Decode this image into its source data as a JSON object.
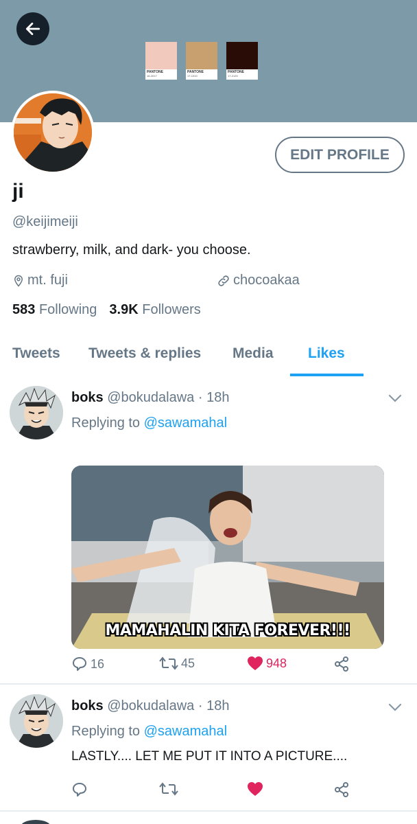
{
  "profile": {
    "name": "ji",
    "handle": "@keijimeiji",
    "bio": "strawberry, milk, and dark- you choose.",
    "location": "mt. fuji",
    "website": "chocoakaa",
    "following_count": "583",
    "following_label": "Following",
    "followers_count": "3.9K",
    "followers_label": "Followers",
    "edit_button": "EDIT PROFILE"
  },
  "banner": {
    "swatches": [
      {
        "brand": "PANTONE",
        "code": "16-2017",
        "color": "#f2c9bd"
      },
      {
        "brand": "PANTONE",
        "code": "17-1010",
        "color": "#c8a070"
      },
      {
        "brand": "PANTONE",
        "code": "17-2120",
        "color": "#2a0c06"
      }
    ]
  },
  "tabs": [
    {
      "label": "Tweets"
    },
    {
      "label": "Tweets & replies"
    },
    {
      "label": "Media"
    },
    {
      "label": "Likes",
      "active": true
    }
  ],
  "tweets": [
    {
      "name": "boks",
      "handle": "@bokudalawa",
      "time": "· 18h",
      "replying_label": "Replying to",
      "replying_to": "@sawamahal",
      "media_caption": "MAMAHALIN KITA FOREVER!!!",
      "replies": "16",
      "retweets": "45",
      "likes": "948"
    },
    {
      "name": "boks",
      "handle": "@bokudalawa",
      "time": "· 18h",
      "replying_label": "Replying to",
      "replying_to": "@sawamahal",
      "text": "LASTLY.... LET ME PUT IT INTO A PICTURE...."
    }
  ],
  "colors": {
    "accent": "#1da1f2",
    "like": "#e0245e",
    "muted": "#657786",
    "banner": "#7c9aa8"
  }
}
